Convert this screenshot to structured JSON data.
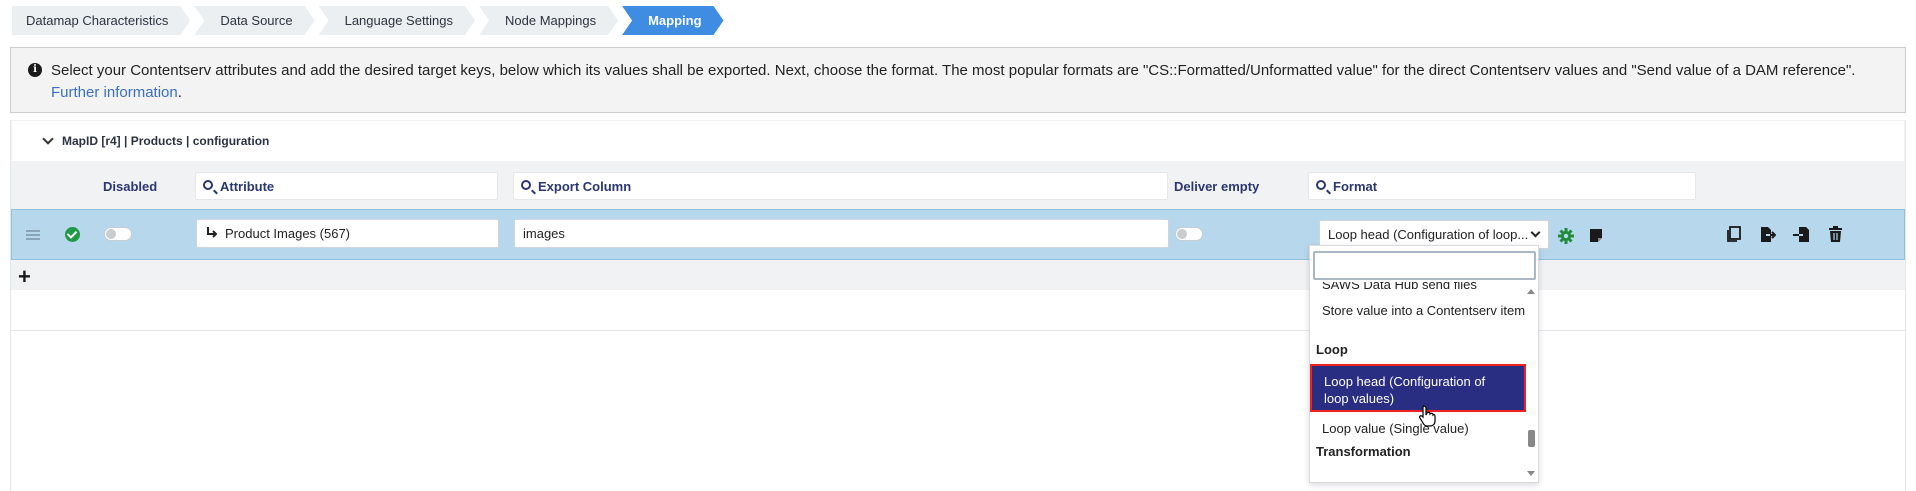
{
  "breadcrumb": {
    "steps": [
      "Datamap Characteristics",
      "Data Source",
      "Language Settings",
      "Node Mappings",
      "Mapping"
    ],
    "active_index": 4
  },
  "info": {
    "text": "Select your Contentserv attributes and add the desired target keys, below which its values shall be exported. Next, choose the format. The most popular formats are \"CS::Formatted/Unformatted value\" for the direct Contentserv values and \"Send value of a DAM reference\".",
    "link": "Further information",
    "suffix": "."
  },
  "mapping": {
    "header": "MapID [r4] | Products | configuration",
    "columns": {
      "disabled": "Disabled",
      "attribute": "Attribute",
      "export_column": "Export Column",
      "deliver_empty": "Deliver empty",
      "format": "Format"
    },
    "row": {
      "status": "valid",
      "disabled": false,
      "attribute": "Product Images (567)",
      "export_column": "images",
      "deliver_empty": false,
      "format": "Loop head (Configuration of loop..."
    },
    "add_label": "+"
  },
  "dropdown": {
    "search_value": "",
    "options": [
      {
        "type": "option",
        "label": "SAWS Data Hub send files"
      },
      {
        "type": "option",
        "label": "Store value into a Contentserv item"
      },
      {
        "type": "group",
        "label": "Loop"
      },
      {
        "type": "option",
        "label": "Loop head (Configuration of loop values)",
        "selected": true
      },
      {
        "type": "option",
        "label": "Loop value (Single value)"
      },
      {
        "type": "group",
        "label": "Transformation"
      }
    ]
  },
  "colors": {
    "accent": "#3f8de2",
    "row_highlight": "#b7d8ec",
    "selected_option": "#2a2e83",
    "success": "#1f9a48",
    "highlight_border": "#ee2222"
  }
}
